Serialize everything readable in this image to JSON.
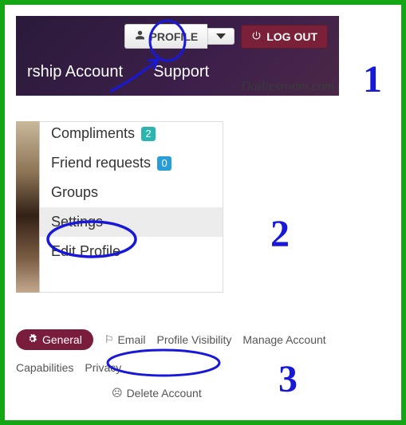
{
  "step1": {
    "profile_label": "PROFILE",
    "logout_label": "LOG OUT",
    "nav_left": "rship Account",
    "nav_support": "Support",
    "watermark": "Dailiesroom.com"
  },
  "step2": {
    "items": [
      {
        "label": "Compliments",
        "badge": "2"
      },
      {
        "label": "Friend requests",
        "badge": "0"
      },
      {
        "label": "Groups"
      },
      {
        "label": "Settings"
      },
      {
        "label": "Edit Profile"
      }
    ]
  },
  "step3": {
    "general": "General",
    "email": "Email",
    "visibility": "Profile Visibility",
    "manage": "Manage Account",
    "capabilities": "Capabilities",
    "privacy": "Privacy",
    "delete": "Delete Account"
  },
  "numbers": {
    "one": "1",
    "two": "2",
    "three": "3"
  }
}
